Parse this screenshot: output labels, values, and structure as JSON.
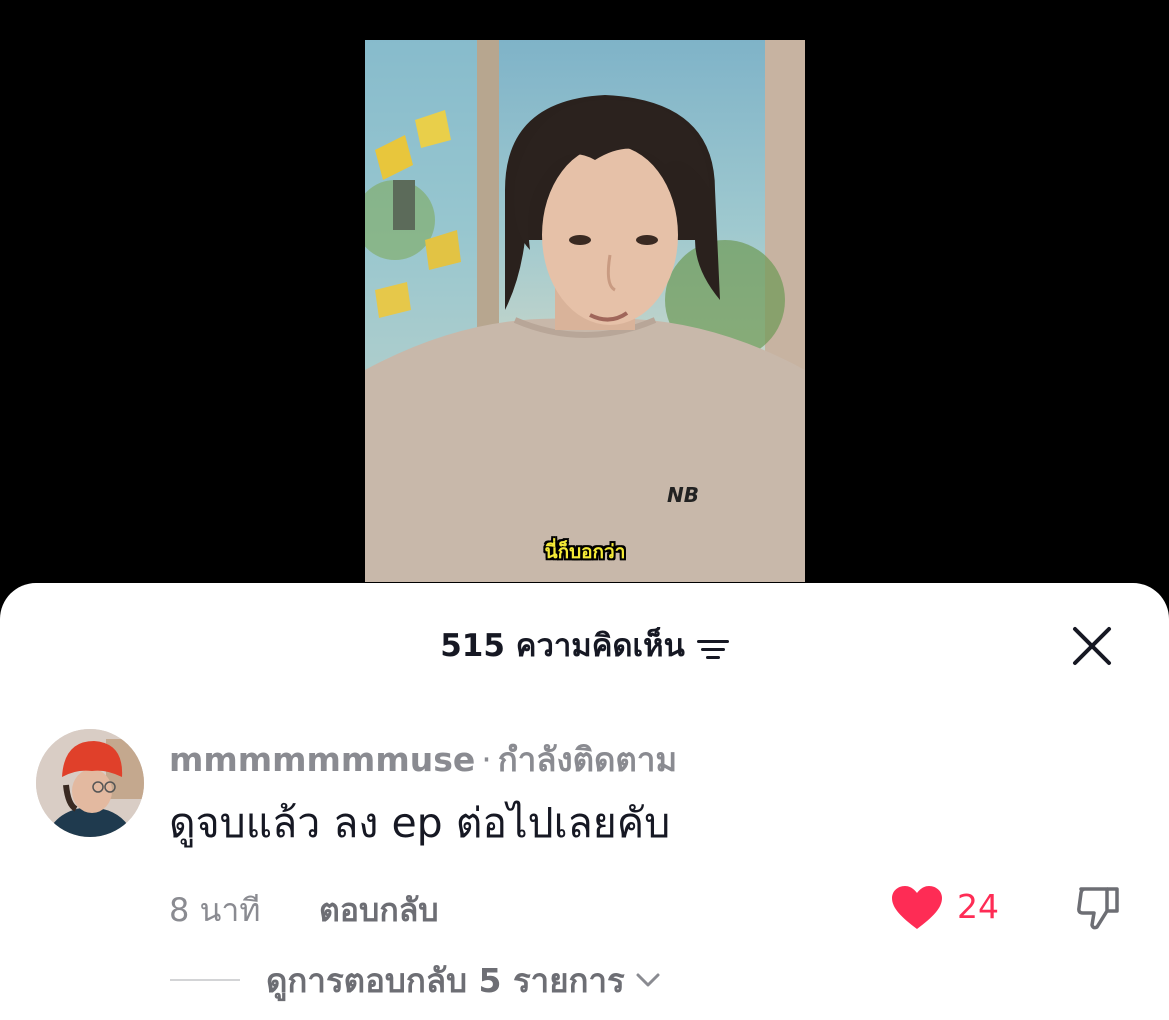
{
  "video": {
    "subtitle": "นี่ก็บอกว่า",
    "shirt_logo": "NB"
  },
  "comments_sheet": {
    "count_label": "515 ความคิดเห็น",
    "sort_icon": "sort-lines-icon",
    "close_icon": "close-icon"
  },
  "comment": {
    "username": "mmmmmmmuse",
    "separator": "·",
    "relation": "กำลังติดตาม",
    "text": "ดูจบแล้ว ลง ep ต่อไปเลยคับ",
    "time": "8 นาที",
    "reply_label": "ตอบกลับ",
    "likes": "24",
    "like_color": "#fe2c55"
  },
  "replies": {
    "label": "ดูการตอบกลับ 5 รายการ"
  }
}
